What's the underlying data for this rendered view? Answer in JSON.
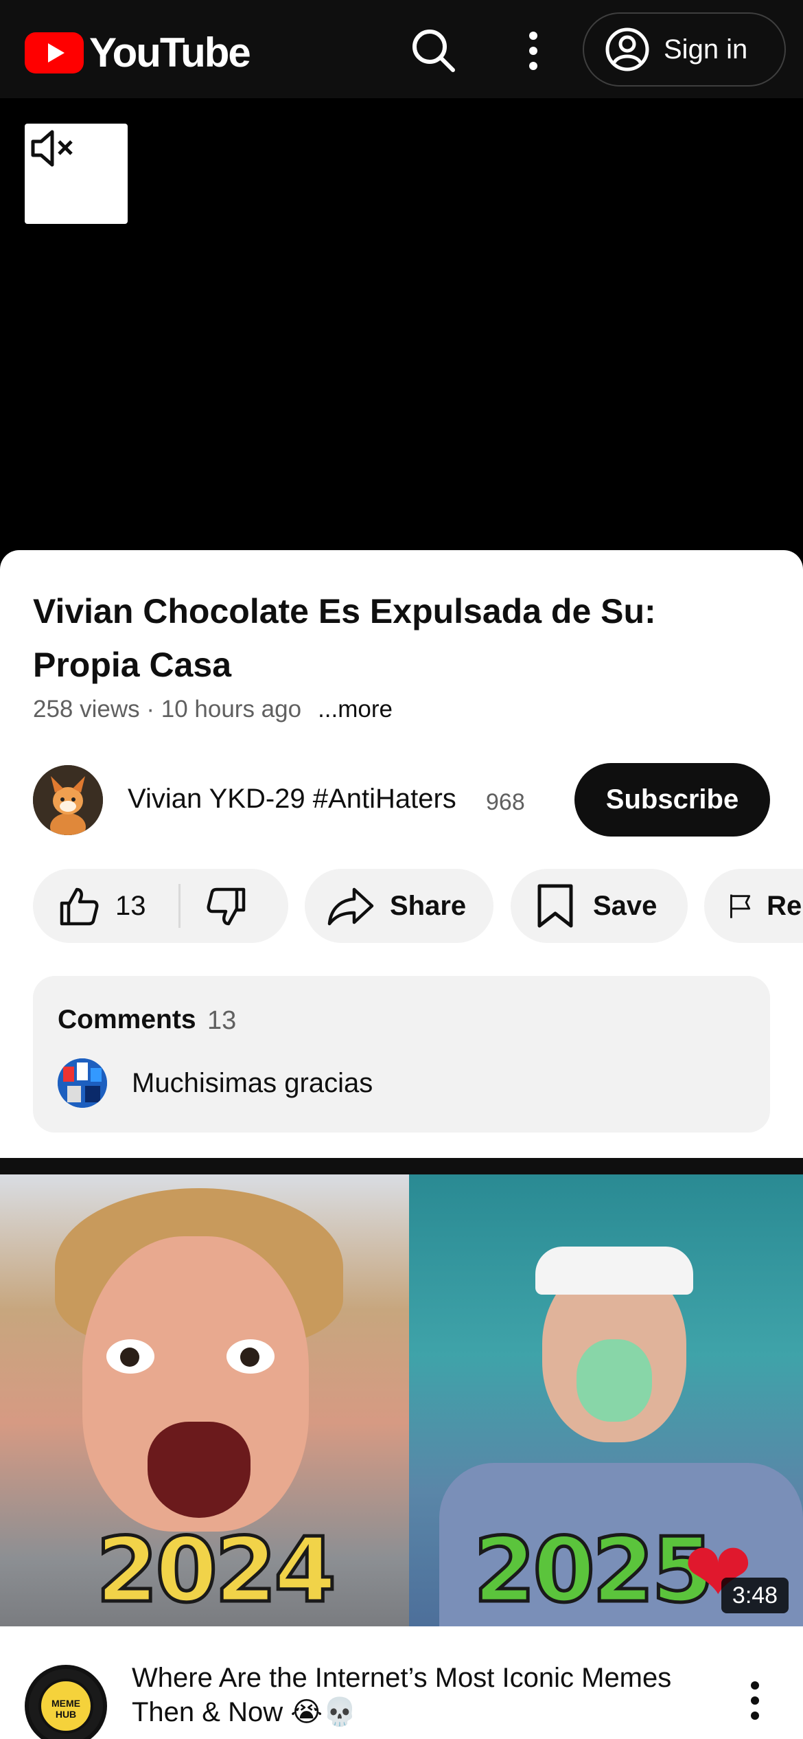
{
  "header": {
    "logo_text": "YouTube",
    "sign_in_label": "Sign in"
  },
  "video": {
    "title": "Vivian Chocolate Es Expulsada de Su: Propia Casa",
    "views": "258 views",
    "age": "10 hours ago",
    "more_label": "...more"
  },
  "channel": {
    "name": "Vivian YKD-29 #AntiHaters",
    "subscriber_count": "968",
    "subscribe_label": "Subscribe"
  },
  "actions": {
    "like_count": "13",
    "share_label": "Share",
    "save_label": "Save",
    "report_label": "Report"
  },
  "comments": {
    "title": "Comments",
    "count": "13",
    "top_comment": "Muchisimas gracias"
  },
  "next_video": {
    "thumb_year_left": "2024",
    "thumb_year_right": "2025",
    "duration": "3:48",
    "title": "Where Are the Internet’s Most Iconic Memes Then & Now 😭💀",
    "channel_badge": "MEME HUB"
  },
  "colors": {
    "brand_red": "#ff0000",
    "header_bg": "#0f0f0f",
    "pill_bg": "#f2f2f2"
  }
}
